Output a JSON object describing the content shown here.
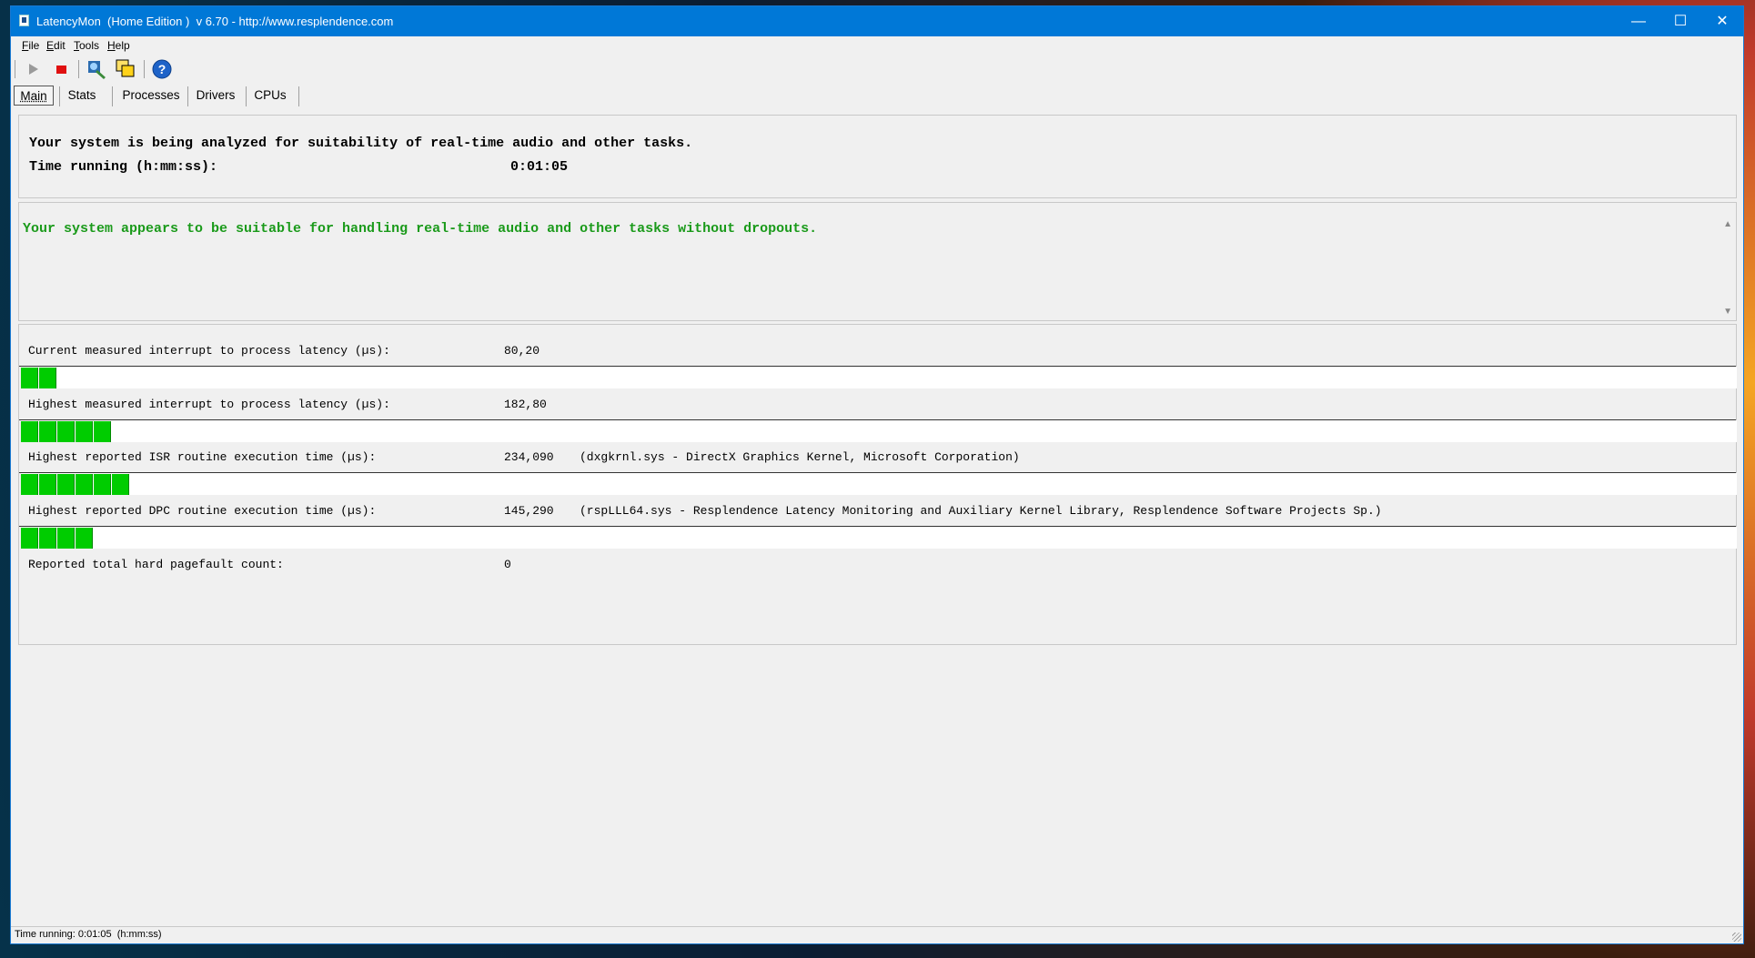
{
  "window": {
    "title": "LatencyMon  (Home Edition )  v 6.70 - http://www.resplendence.com",
    "controls": {
      "minimize": "—",
      "maximize": "☐",
      "close": "✕"
    }
  },
  "menu": [
    "File",
    "Edit",
    "Tools",
    "Help"
  ],
  "toolbar": {
    "buttons": [
      "play-icon",
      "stop-icon",
      "analyze-icon",
      "windows-icon",
      "help-icon"
    ]
  },
  "tabs": [
    {
      "label": "Main",
      "active": true
    },
    {
      "label": "Stats",
      "active": false
    },
    {
      "label": "Processes",
      "active": false
    },
    {
      "label": "Drivers",
      "active": false
    },
    {
      "label": "CPUs",
      "active": false
    }
  ],
  "header": {
    "line1": "Your system is being analyzed for suitability of real-time audio and other tasks.",
    "time_label": "Time running (h:mm:ss):",
    "time_value": "0:01:05"
  },
  "result": {
    "text": "Your system appears to be suitable for handling real-time audio and other tasks without dropouts.",
    "color": "#1a9a1a"
  },
  "metrics": [
    {
      "label": "Current measured interrupt to process latency (µs):",
      "value": "80,20",
      "detail": "",
      "meter_segments": 2
    },
    {
      "label": "Highest measured interrupt to process latency (µs):",
      "value": "182,80",
      "detail": "",
      "meter_segments": 5
    },
    {
      "label": "Highest reported ISR routine execution time (µs):",
      "value": "234,090",
      "detail": "(dxgkrnl.sys - DirectX Graphics Kernel, Microsoft Corporation)",
      "meter_segments": 6
    },
    {
      "label": "Highest reported DPC routine execution time (µs):",
      "value": "145,290",
      "detail": "(rspLLL64.sys - Resplendence Latency Monitoring and Auxiliary Kernel Library, Resplendence Software Projects Sp.)",
      "meter_segments": 4
    },
    {
      "label": "Reported total hard pagefault count:",
      "value": "0",
      "detail": ""
    }
  ],
  "statusbar": {
    "text": "Time running: 0:01:05  (h:mm:ss)"
  },
  "colors": {
    "titlebar": "#0078d7",
    "meter_fill": "#00cc00",
    "result_text": "#1a9a1a"
  }
}
